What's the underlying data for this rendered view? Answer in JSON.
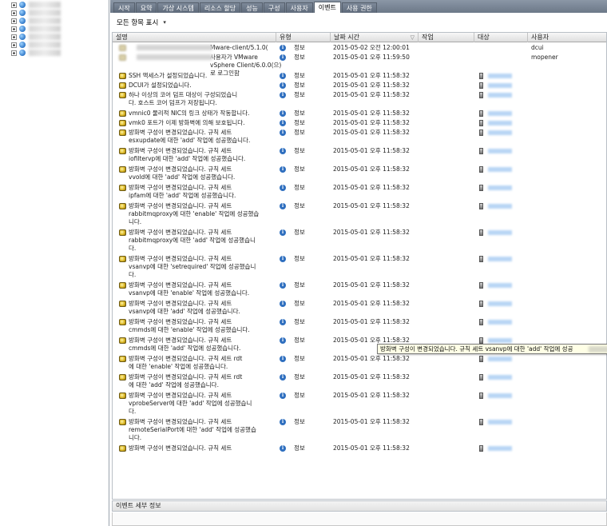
{
  "tabs": [
    {
      "label": "시작",
      "active": false
    },
    {
      "label": "요약",
      "active": false
    },
    {
      "label": "가상 시스템",
      "active": false
    },
    {
      "label": "리소스 할당",
      "active": false
    },
    {
      "label": "성능",
      "active": false
    },
    {
      "label": "구성",
      "active": false
    },
    {
      "label": "사용자",
      "active": false
    },
    {
      "label": "이벤트",
      "active": true
    },
    {
      "label": "사용 권한",
      "active": false
    }
  ],
  "toolbar": {
    "filter_label": "모든 항목 표시",
    "filter_arrow": "▾"
  },
  "columns": {
    "desc": "설명",
    "type": "유형",
    "date": "날짜 시간",
    "task": "작업",
    "target": "대상",
    "user": "사용자"
  },
  "sort_indicator": "▽",
  "events": [
    {
      "desc": "Mware-client/5.1.0(",
      "type": "정보",
      "date": "2015-05-02 오전 12:00:01",
      "user": "dcui",
      "target_icon": false,
      "desc_blurred": true
    },
    {
      "desc": "사용자가 VMware\nvSphere Client/6.0.0(으)로 로그인함",
      "type": "정보",
      "date": "2015-05-01 오후 11:59:50",
      "user": "mopener",
      "target_icon": false,
      "desc_blurred": true
    },
    {
      "desc": "SSH 액세스가 설정되었습니다.",
      "type": "정보",
      "date": "2015-05-01 오후 11:58:32",
      "user": "",
      "target_icon": true
    },
    {
      "desc": "DCUI가 설정되었습니다.",
      "type": "정보",
      "date": "2015-05-01 오후 11:58:32",
      "user": "",
      "target_icon": true
    },
    {
      "desc": "하나 이상의 코어 덤프 대상이 구성되었습니\n다. 호스트 코어 덤프가 저장됩니다.",
      "type": "정보",
      "date": "2015-05-01 오후 11:58:32",
      "user": "",
      "target_icon": true
    },
    {
      "desc": "vmnic0 물리적 NIC의 링크 상태가 작동합니다.",
      "type": "정보",
      "date": "2015-05-01 오후 11:58:32",
      "user": "",
      "target_icon": true
    },
    {
      "desc": "vmk0 포트가 이제 방화벽에 의해 보호됩니다.",
      "type": "정보",
      "date": "2015-05-01 오후 11:58:32",
      "user": "",
      "target_icon": true
    },
    {
      "desc": "방화벽 구성이 변경되었습니다. 규칙 세트\nesxupdate에 대한 'add' 작업에 성공했습니다.",
      "type": "정보",
      "date": "2015-05-01 오후 11:58:32",
      "user": "",
      "target_icon": true
    },
    {
      "desc": "방화벽 구성이 변경되었습니다. 규칙 세트\niofiltervp에 대한 'add' 작업에 성공했습니다.",
      "type": "정보",
      "date": "2015-05-01 오후 11:58:32",
      "user": "",
      "target_icon": true
    },
    {
      "desc": "방화벽 구성이 변경되었습니다. 규칙 세트\nvvold에 대한 'add' 작업에 성공했습니다.",
      "type": "정보",
      "date": "2015-05-01 오후 11:58:32",
      "user": "",
      "target_icon": true
    },
    {
      "desc": "방화벽 구성이 변경되었습니다. 규칙 세트\nipfam에 대한 'add' 작업에 성공했습니다.",
      "type": "정보",
      "date": "2015-05-01 오후 11:58:32",
      "user": "",
      "target_icon": true
    },
    {
      "desc": "방화벽 구성이 변경되었습니다. 규칙 세트\nrabbitmqproxy에 대한 'enable' 작업에 성공했습\n니다.",
      "type": "정보",
      "date": "2015-05-01 오후 11:58:32",
      "user": "",
      "target_icon": true
    },
    {
      "desc": "방화벽 구성이 변경되었습니다. 규칙 세트\nrabbitmqproxy에 대한 'add' 작업에 성공했습니\n다.",
      "type": "정보",
      "date": "2015-05-01 오후 11:58:32",
      "user": "",
      "target_icon": true
    },
    {
      "desc": "방화벽 구성이 변경되었습니다. 규칙 세트\nvsanvp에 대한 'setrequired' 작업에 성공했습니\n다.",
      "type": "정보",
      "date": "2015-05-01 오후 11:58:32",
      "user": "",
      "target_icon": true
    },
    {
      "desc": "방화벽 구성이 변경되었습니다. 규칙 세트\nvsanvp에 대한 'enable' 작업에 성공했습니다.",
      "type": "정보",
      "date": "2015-05-01 오후 11:58:32",
      "user": "",
      "target_icon": true
    },
    {
      "desc": "방화벽 구성이 변경되었습니다. 규칙 세트\nvsanvp에 대한 'add' 작업에 성공했습니다.",
      "type": "정보",
      "date": "2015-05-01 오후 11:58:32",
      "user": "",
      "target_icon": true
    },
    {
      "desc": "방화벽 구성이 변경되었습니다. 규칙 세트\ncmmds에 대한 'enable' 작업에 성공했습니다.",
      "type": "정보",
      "date": "2015-05-01 오후 11:58:32",
      "user": "",
      "target_icon": true
    },
    {
      "desc": "방화벽 구성이 변경되었습니다. 규칙 세트\ncmmds에 대한 'add' 작업에 성공했습니다.",
      "type": "정보",
      "date": "2015-05-01 오후 11:58:32",
      "user": "",
      "target_icon": true
    },
    {
      "desc": "방화벽 구성이 변경되었습니다. 규칙 세트 rdt\n에 대한 'enable' 작업에 성공했습니다.",
      "type": "정보",
      "date": "2015-05-01 오후 11:58:32",
      "user": "",
      "target_icon": true
    },
    {
      "desc": "방화벽 구성이 변경되었습니다. 규칙 세트 rdt\n에 대한 'add' 작업에 성공했습니다.",
      "type": "정보",
      "date": "2015-05-01 오후 11:58:32",
      "user": "",
      "target_icon": true
    },
    {
      "desc": "방화벽 구성이 변경되었습니다. 규칙 세트\nvprobeServer에 대한 'add' 작업에 성공했습니\n다.",
      "type": "정보",
      "date": "2015-05-01 오후 11:58:32",
      "user": "",
      "target_icon": true
    },
    {
      "desc": "방화벽 구성이 변경되었습니다. 규칙 세트\nremoteSerialPort에 대한 'add' 작업에 성공했습\n니다.",
      "type": "정보",
      "date": "2015-05-01 오후 11:58:32",
      "user": "",
      "target_icon": true
    },
    {
      "desc": "방화벽 구성이 변경되었습니다. 규칙 세트",
      "type": "정보",
      "date": "2015-05-01 오후 11:58:32",
      "user": "",
      "target_icon": true
    }
  ],
  "tooltip": {
    "text": "방화벽 구성이 변경되었습니다. 규칙 세트 vsanvp에 대한 'add' 작업에 성공"
  },
  "details_panel": {
    "title": "이벤트 세부 정보"
  },
  "colors": {
    "tab_active": "#ffffff",
    "tab_inactive": "#6c7888",
    "tooltip_bg": "#ffffe6",
    "target_blur": "#b9d6f5"
  },
  "icons": {
    "tree_expand": "plus-box-icon",
    "tree_node": "globe-icon",
    "event": "event-icon",
    "info": "info-icon",
    "target": "host-icon"
  }
}
